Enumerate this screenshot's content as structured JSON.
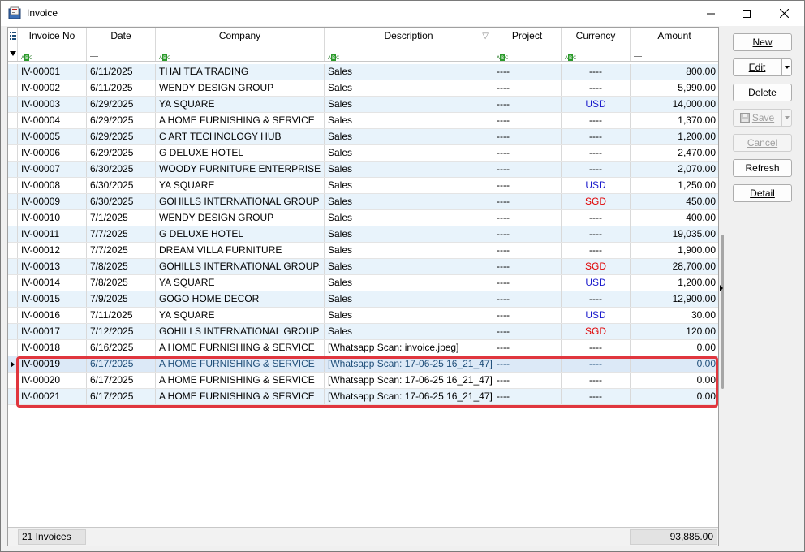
{
  "window": {
    "title": "Invoice"
  },
  "columns": {
    "invoice_no": "Invoice No",
    "date": "Date",
    "company": "Company",
    "description": "Description",
    "project": "Project",
    "currency": "Currency",
    "amount": "Amount"
  },
  "rows": [
    {
      "invoice_no": "IV-00001",
      "date": "6/11/2025",
      "company": "THAI TEA TRADING",
      "description": "Sales",
      "project": "----",
      "currency": "----",
      "amount": "800.00"
    },
    {
      "invoice_no": "IV-00002",
      "date": "6/11/2025",
      "company": "WENDY DESIGN GROUP",
      "description": "Sales",
      "project": "----",
      "currency": "----",
      "amount": "5,990.00"
    },
    {
      "invoice_no": "IV-00003",
      "date": "6/29/2025",
      "company": "YA SQUARE",
      "description": "Sales",
      "project": "----",
      "currency": "USD",
      "amount": "14,000.00"
    },
    {
      "invoice_no": "IV-00004",
      "date": "6/29/2025",
      "company": "A HOME FURNISHING & SERVICE",
      "description": "Sales",
      "project": "----",
      "currency": "----",
      "amount": "1,370.00"
    },
    {
      "invoice_no": "IV-00005",
      "date": "6/29/2025",
      "company": "C ART TECHNOLOGY HUB",
      "description": "Sales",
      "project": "----",
      "currency": "----",
      "amount": "1,200.00"
    },
    {
      "invoice_no": "IV-00006",
      "date": "6/29/2025",
      "company": "G DELUXE HOTEL",
      "description": "Sales",
      "project": "----",
      "currency": "----",
      "amount": "2,470.00"
    },
    {
      "invoice_no": "IV-00007",
      "date": "6/30/2025",
      "company": "WOODY FURNITURE ENTERPRISE",
      "description": "Sales",
      "project": "----",
      "currency": "----",
      "amount": "2,070.00"
    },
    {
      "invoice_no": "IV-00008",
      "date": "6/30/2025",
      "company": "YA SQUARE",
      "description": "Sales",
      "project": "----",
      "currency": "USD",
      "amount": "1,250.00"
    },
    {
      "invoice_no": "IV-00009",
      "date": "6/30/2025",
      "company": "GOHILLS INTERNATIONAL GROUP",
      "description": "Sales",
      "project": "----",
      "currency": "SGD",
      "amount": "450.00"
    },
    {
      "invoice_no": "IV-00010",
      "date": "7/1/2025",
      "company": "WENDY DESIGN GROUP",
      "description": "Sales",
      "project": "----",
      "currency": "----",
      "amount": "400.00"
    },
    {
      "invoice_no": "IV-00011",
      "date": "7/7/2025",
      "company": "G DELUXE HOTEL",
      "description": "Sales",
      "project": "----",
      "currency": "----",
      "amount": "19,035.00"
    },
    {
      "invoice_no": "IV-00012",
      "date": "7/7/2025",
      "company": "DREAM VILLA FURNITURE",
      "description": "Sales",
      "project": "----",
      "currency": "----",
      "amount": "1,900.00"
    },
    {
      "invoice_no": "IV-00013",
      "date": "7/8/2025",
      "company": "GOHILLS INTERNATIONAL GROUP",
      "description": "Sales",
      "project": "----",
      "currency": "SGD",
      "amount": "28,700.00"
    },
    {
      "invoice_no": "IV-00014",
      "date": "7/8/2025",
      "company": "YA SQUARE",
      "description": "Sales",
      "project": "----",
      "currency": "USD",
      "amount": "1,200.00"
    },
    {
      "invoice_no": "IV-00015",
      "date": "7/9/2025",
      "company": "GOGO HOME DECOR",
      "description": "Sales",
      "project": "----",
      "currency": "----",
      "amount": "12,900.00"
    },
    {
      "invoice_no": "IV-00016",
      "date": "7/11/2025",
      "company": "YA SQUARE",
      "description": "Sales",
      "project": "----",
      "currency": "USD",
      "amount": "30.00"
    },
    {
      "invoice_no": "IV-00017",
      "date": "7/12/2025",
      "company": "GOHILLS INTERNATIONAL GROUP",
      "description": "Sales",
      "project": "----",
      "currency": "SGD",
      "amount": "120.00"
    },
    {
      "invoice_no": "IV-00018",
      "date": "6/16/2025",
      "company": "A HOME FURNISHING & SERVICE",
      "description": "[Whatsapp Scan: invoice.jpeg]",
      "project": "----",
      "currency": "----",
      "amount": "0.00"
    },
    {
      "invoice_no": "IV-00019",
      "date": "6/17/2025",
      "company": "A HOME FURNISHING & SERVICE",
      "description": "[Whatsapp Scan: 17-06-25 16_21_47]",
      "project": "----",
      "currency": "----",
      "amount": "0.00"
    },
    {
      "invoice_no": "IV-00020",
      "date": "6/17/2025",
      "company": "A HOME FURNISHING & SERVICE",
      "description": "[Whatsapp Scan: 17-06-25 16_21_47]",
      "project": "----",
      "currency": "----",
      "amount": "0.00"
    },
    {
      "invoice_no": "IV-00021",
      "date": "6/17/2025",
      "company": "A HOME FURNISHING & SERVICE",
      "description": "[Whatsapp Scan: 17-06-25 16_21_47]",
      "project": "----",
      "currency": "----",
      "amount": "0.00"
    }
  ],
  "selected_row": 18,
  "footer": {
    "count": "21 Invoices",
    "total": "93,885.00"
  },
  "buttons": {
    "new": "New",
    "edit": "Edit",
    "delete": "Delete",
    "save": "Save",
    "cancel": "Cancel",
    "refresh": "Refresh",
    "detail": "Detail"
  },
  "colors": {
    "usd": "#1a1acc",
    "sgd": "#e00000",
    "highlight": "#e0363e",
    "alt_row": "#e8f3fb"
  }
}
